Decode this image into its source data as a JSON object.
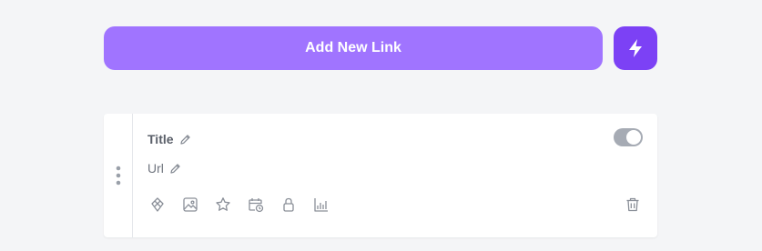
{
  "header": {
    "add_link_label": "Add New Link",
    "icons": {
      "bolt": "bolt-icon"
    }
  },
  "link_card": {
    "title": "Title",
    "url": "Url",
    "enabled": true,
    "icons": [
      "drag-handle-icon",
      "pencil-icon",
      "layout-icon",
      "thumbnail-icon",
      "star-icon",
      "schedule-icon",
      "lock-icon",
      "analytics-icon",
      "trash-icon"
    ]
  },
  "colors": {
    "background": "#f4f5f7",
    "add_button": "#a074ff",
    "bolt_button": "#7c41f5",
    "toggle": "#a6abb4",
    "icon": "#8a8f98"
  }
}
